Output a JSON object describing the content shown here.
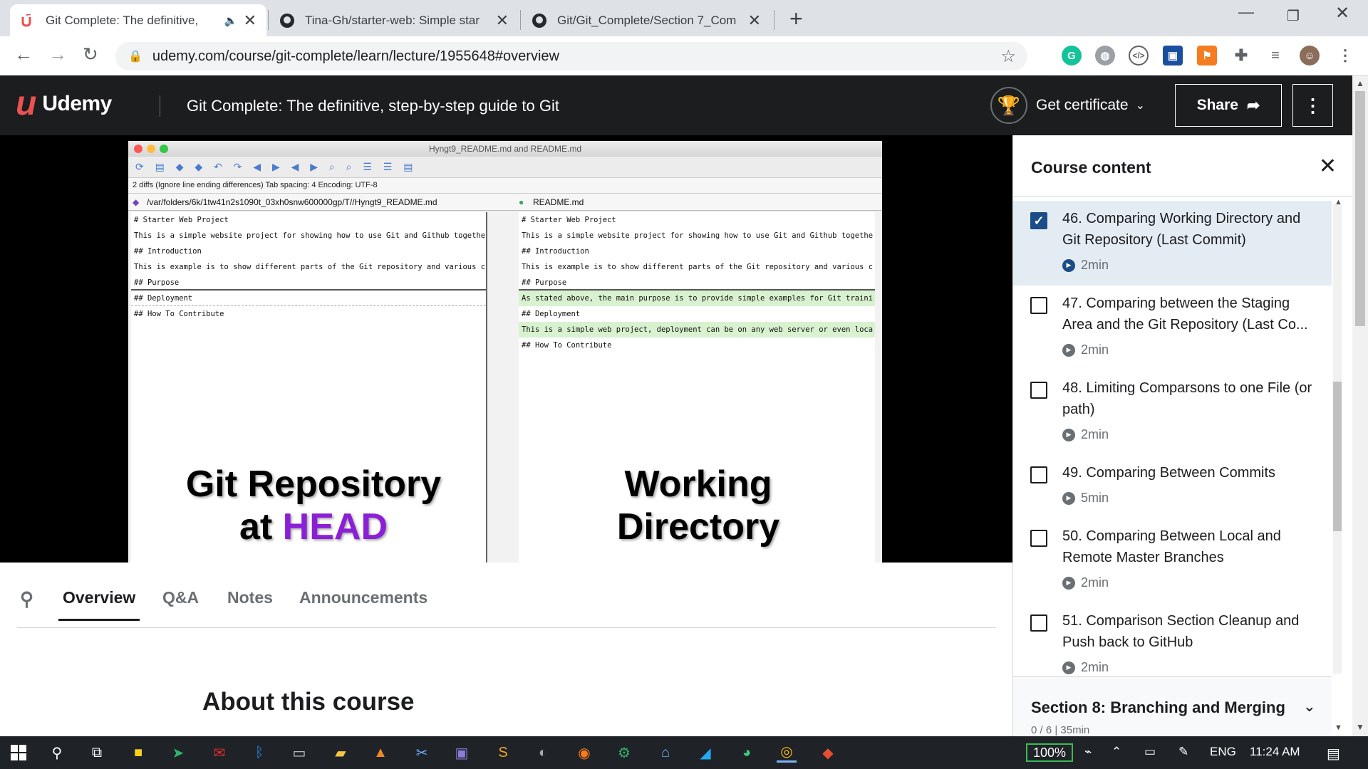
{
  "browser": {
    "tabs": [
      {
        "title": "Git Complete: The definitive, ",
        "favicon": "udemy-icon",
        "active": true
      },
      {
        "title": "Tina-Gh/starter-web: Simple star",
        "favicon": "github-icon",
        "active": false
      },
      {
        "title": "Git/Git_Complete/Section 7_Com",
        "favicon": "github-icon",
        "active": false
      }
    ],
    "url": "udemy.com/course/git-complete/learn/lecture/1955648#overview"
  },
  "header": {
    "logo_text": "Udemy",
    "course_title": "Git Complete: The definitive, step-by-step guide to Git",
    "certificate_label": "Get certificate",
    "share_label": "Share"
  },
  "video": {
    "window_title": "Hyngt9_README.md and README.md",
    "info_bar": "2 diffs (Ignore line ending differences)   Tab spacing: 4   Encoding: UTF-8",
    "left_path": "/var/folders/6k/1tw41n2s1090t_03xh0snw600000gp/T//Hyngt9_README.md",
    "right_path": "README.md",
    "left_lines": [
      "# Starter Web Project",
      "This is a simple website project for showing how to use Git and Github togethe",
      "## Introduction",
      "This is example is to show different parts of the Git repository and various c",
      "## Purpose",
      "## Deployment",
      "## How To Contribute"
    ],
    "right_lines": [
      "# Starter Web Project",
      "This is a simple website project for showing how to use Git and Github togethe",
      "## Introduction",
      "This is example is to show different parts of the Git repository and various c",
      "## Purpose",
      "As stated above, the main purpose is to provide simple examples for Git traini",
      "## Deployment",
      "This is a simple web project, deployment can be on any web server or even loca",
      "## How To Contribute"
    ],
    "left_caption_line1": "Git Repository",
    "left_caption_at": "at ",
    "left_caption_head": "HEAD",
    "right_caption_line1": "Working",
    "right_caption_line2": "Directory"
  },
  "lower_tabs": {
    "items": [
      "Overview",
      "Q&A",
      "Notes",
      "Announcements"
    ],
    "active": "Overview"
  },
  "about_heading": "About this course",
  "sidebar": {
    "title": "Course content",
    "lectures": [
      {
        "title": "46. Comparing Working Directory and Git Repository (Last Commit)",
        "duration": "2min",
        "checked": true,
        "active": true
      },
      {
        "title": "47. Comparing between the Staging Area and the Git Repository (Last Co...",
        "duration": "2min",
        "checked": false,
        "active": false
      },
      {
        "title": "48. Limiting Comparsons to one File (or path)",
        "duration": "2min",
        "checked": false,
        "active": false
      },
      {
        "title": "49. Comparing Between Commits",
        "duration": "5min",
        "checked": false,
        "active": false
      },
      {
        "title": "50. Comparing Between Local and Remote Master Branches",
        "duration": "2min",
        "checked": false,
        "active": false
      },
      {
        "title": "51. Comparison Section Cleanup and Push back to GitHub",
        "duration": "2min",
        "checked": false,
        "active": false
      }
    ],
    "section_title": "Section 8: Branching and Merging",
    "section_sub": "0 / 6 | 35min"
  },
  "taskbar": {
    "zoom": "100%",
    "language": "ENG",
    "time": "11:24 AM"
  },
  "colors": {
    "udemy_red": "#ea5252",
    "header_bg": "#1c1d1f",
    "active_lecture_bg": "#e3ecf3",
    "checkbox_blue": "#1c4d86",
    "head_purple": "#8b1fd6"
  }
}
